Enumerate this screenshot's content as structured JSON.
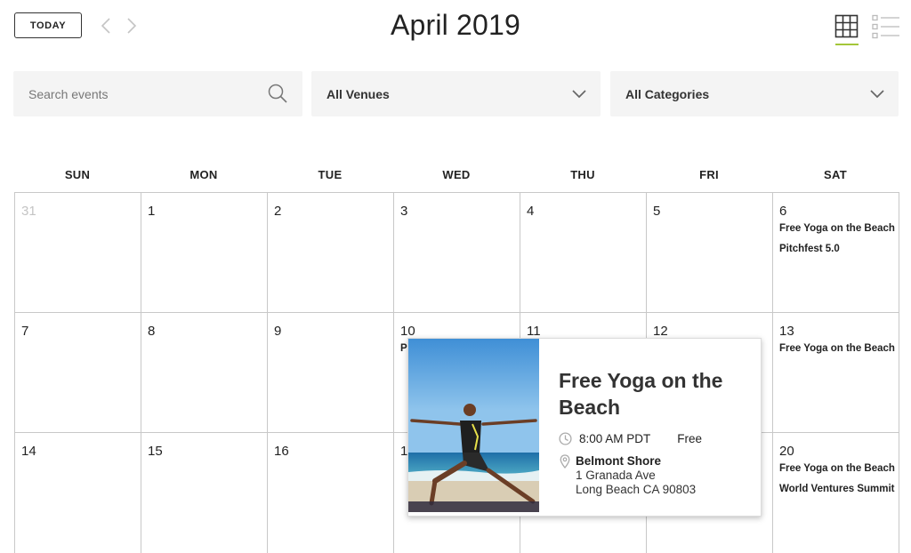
{
  "header": {
    "today_label": "TODAY",
    "month_title": "April 2019"
  },
  "filters": {
    "search_placeholder": "Search events",
    "search_value": "",
    "venues_selected": "All Venues",
    "categories_selected": "All Categories"
  },
  "weekdays": [
    "SUN",
    "MON",
    "TUE",
    "WED",
    "THU",
    "FRI",
    "SAT"
  ],
  "weeks": [
    {
      "days": [
        {
          "label": "31",
          "muted": true,
          "events": []
        },
        {
          "label": "1",
          "events": []
        },
        {
          "label": "2",
          "events": []
        },
        {
          "label": "3",
          "events": []
        },
        {
          "label": "4",
          "events": []
        },
        {
          "label": "5",
          "events": []
        },
        {
          "label": "6",
          "events": [
            "Free Yoga on the Beach",
            "Pitchfest 5.0"
          ]
        }
      ]
    },
    {
      "days": [
        {
          "label": "7",
          "events": []
        },
        {
          "label": "8",
          "events": []
        },
        {
          "label": "9",
          "events": []
        },
        {
          "label": "10",
          "events": [
            "P"
          ]
        },
        {
          "label": "11",
          "events": []
        },
        {
          "label": "12",
          "events": []
        },
        {
          "label": "13",
          "events": [
            "Free Yoga on the Beach"
          ]
        }
      ]
    },
    {
      "days": [
        {
          "label": "14",
          "events": []
        },
        {
          "label": "15",
          "events": []
        },
        {
          "label": "16",
          "events": []
        },
        {
          "label": "1",
          "events": []
        },
        {
          "label": "",
          "events": []
        },
        {
          "label": "",
          "events": []
        },
        {
          "label": "20",
          "events": [
            "Free Yoga on the Beach",
            "World Ventures Summit"
          ]
        }
      ]
    }
  ],
  "popup": {
    "title": "Free Yoga on the Beach",
    "time": "8:00 AM PDT",
    "cost": "Free",
    "venue_name": "Belmont Shore",
    "address_line1": "1 Granada Ave",
    "address_line2": "Long Beach CA 90803"
  },
  "colors": {
    "accent_underline": "#a4c639",
    "filter_background": "#f4f4f4",
    "grid_border": "#c8c8c8"
  },
  "icons": {
    "prev": "chevron-left-icon",
    "next": "chevron-right-icon",
    "grid_view": "month-grid-icon",
    "list_view": "list-view-icon",
    "search": "search-icon",
    "dropdown": "chevron-down-icon",
    "time": "clock-icon",
    "location": "map-pin-icon"
  }
}
